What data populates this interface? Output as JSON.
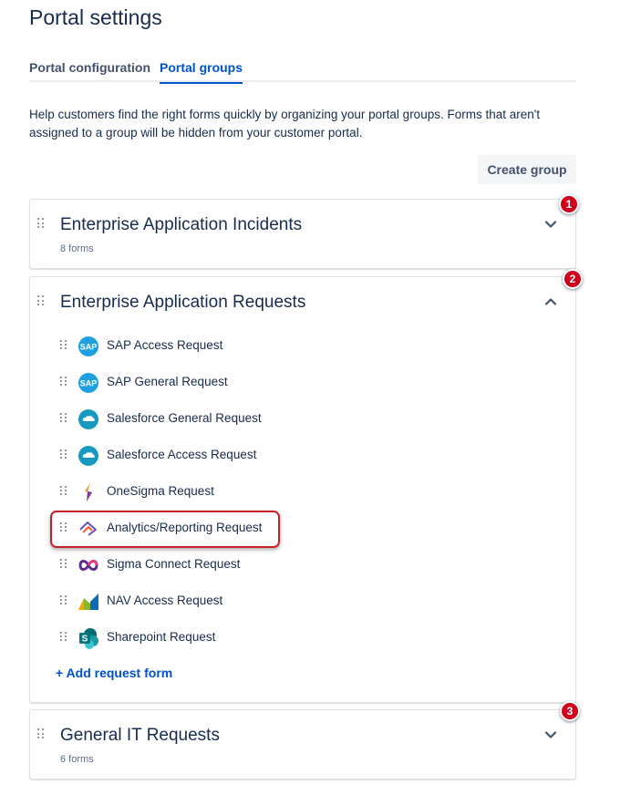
{
  "page": {
    "title": "Portal settings"
  },
  "tabs": [
    {
      "label": "Portal configuration",
      "active": false
    },
    {
      "label": "Portal groups",
      "active": true
    }
  ],
  "help_text": "Help customers find the right forms quickly by organizing your portal groups. Forms that aren't assigned to a group will be hidden from your customer portal.",
  "create_group_label": "Create group",
  "groups": [
    {
      "title": "Enterprise Application Incidents",
      "count": "8 forms",
      "expanded": false,
      "badge": "1"
    },
    {
      "title": "Enterprise Application Requests",
      "expanded": true,
      "badge": "2",
      "items": [
        {
          "label": "SAP Access Request",
          "icon": "sap-icon"
        },
        {
          "label": "SAP General Request",
          "icon": "sap-icon"
        },
        {
          "label": "Salesforce General Request",
          "icon": "salesforce-icon"
        },
        {
          "label": "Salesforce Access Request",
          "icon": "salesforce-icon"
        },
        {
          "label": "OneSigma Request",
          "icon": "onesigma-icon"
        },
        {
          "label": "Analytics/Reporting Request",
          "icon": "analytics-icon",
          "highlighted": true
        },
        {
          "label": "Sigma Connect Request",
          "icon": "sigma-connect-icon"
        },
        {
          "label": "NAV Access Request",
          "icon": "dynamics-nav-icon"
        },
        {
          "label": "Sharepoint Request",
          "icon": "sharepoint-icon"
        }
      ],
      "add_label": "+ Add request form"
    },
    {
      "title": "General IT Requests",
      "count": "6 forms",
      "expanded": false,
      "badge": "3"
    }
  ],
  "colors": {
    "accent": "#0052cc",
    "badge": "#d0021b",
    "highlight": "#c9202a",
    "text": "#172b4d"
  }
}
